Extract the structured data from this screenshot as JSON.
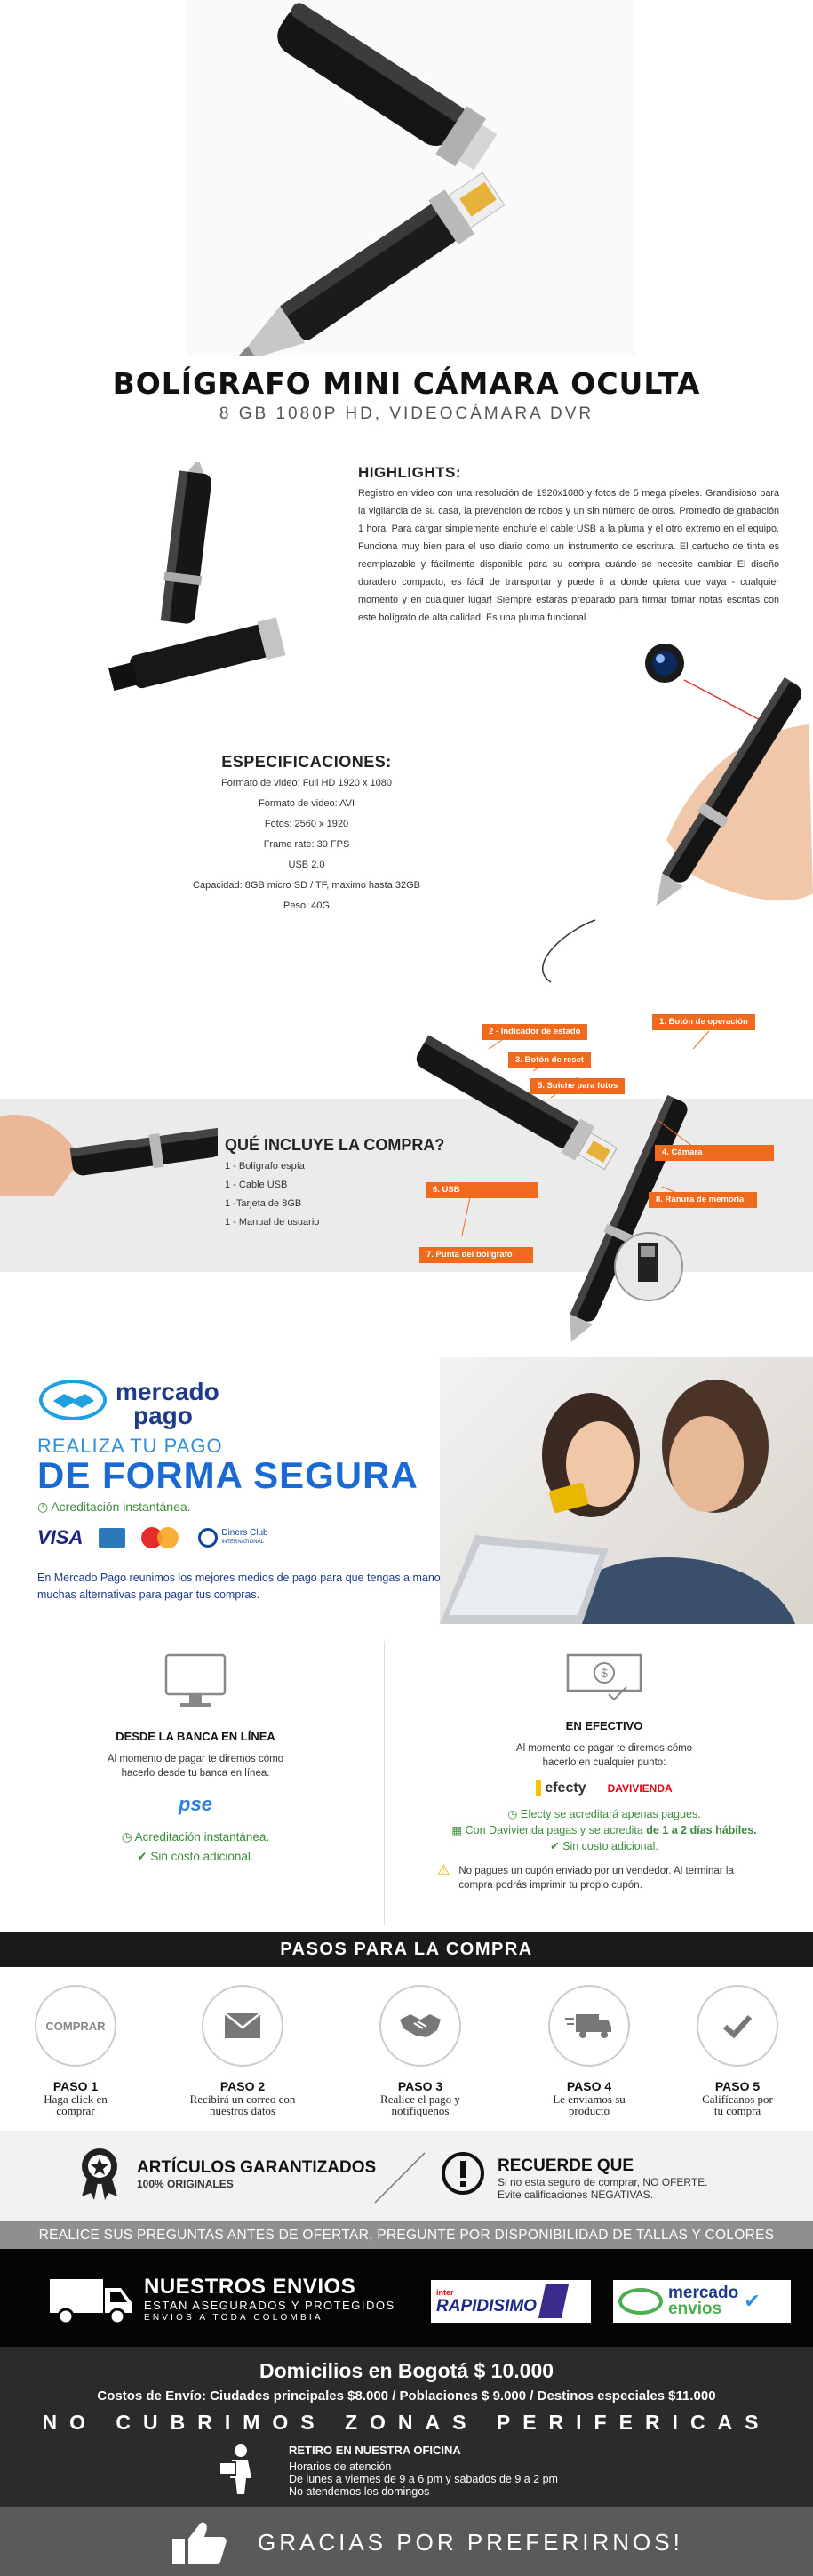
{
  "header": {
    "title": "BOLÍGRAFO MINI CÁMARA OCULTA",
    "subtitle": "8 GB 1080P HD, VIDEOCÁMARA DVR"
  },
  "highlights": {
    "title": "HIGHLIGHTS:",
    "text": "Registro en video con una resolución de 1920x1080 y fotos de 5 mega píxeles. Grandisioso para la vigilancia de su casa, la prevención de robos y un sin número de otros. Promedio de grabación 1 hora. Para cargar simplemente enchufe el cable USB a la pluma y el otro extremo en el equipo. Funciona muy bien para el uso diario como un instrumento de escritura. El cartucho de tinta es reemplazable y fácilmente disponible para su compra cuándo se necesite cambiar El diseño duradero compacto, es fácil de transportar y puede ir a donde quiera que vaya - cualquier momento y en cualquier lugar! Siempre estarás preparado para firmar  tomar notas escritas con este bolígrafo de alta calidad. Es una pluma funcional."
  },
  "specs": {
    "title": "ESPECIFICACIONES:",
    "items": [
      "Formato de video: Full HD 1920 x 1080",
      "Formato de video: AVI",
      "Fotos: 2560 x 1920",
      "Frame rate: 30 FPS",
      "USB 2.0",
      "Capacidad: 8GB micro SD / TF, maximo hasta 32GB",
      "Peso: 40G"
    ]
  },
  "includes": {
    "title": "QUÉ INCLUYE LA COMPRA?",
    "items": [
      "1 - Bolígrafo espía",
      "1 - Cable USB",
      "1 -Tarjeta de 8GB",
      "1 - Manual de usuario"
    ]
  },
  "diagram_tags": {
    "t1": "1. Botón de operación",
    "t2": "2 - Indicador de estado",
    "t3": "3. Botón de reset",
    "t4": "4. Cámara",
    "t5": "5. Suiche para fotos",
    "t6": "6. USB",
    "t7": "7. Punta del bolígrafo",
    "t8": "8. Ranura de memoria"
  },
  "mercadopago": {
    "logo_line1": "mercado",
    "logo_line2": "pago",
    "realiza": "REALIZA TU PAGO",
    "forma": "DE FORMA SEGURA",
    "acreditacion": "Acreditación instantánea.",
    "cards": [
      "VISA",
      "Diners Club"
    ],
    "cards_sub": "INTERNATIONAL",
    "description": "En Mercado Pago reunimos los mejores medios de pago para que tengas a mano muchas alternativas para pagar tus compras."
  },
  "pay_bank": {
    "title": "DESDE LA BANCA EN LÍNEA",
    "text": "Al momento de pagar te diremos cómo hacerlo desde tu banca en línea.",
    "pse": "pse",
    "acred": "Acreditación instantánea.",
    "nocost": "Sin costo adicional."
  },
  "pay_cash": {
    "title": "EN EFECTIVO",
    "text": "Al momento de pagar te diremos cómo hacerlo en cualquier punto:",
    "efecty": "efecty",
    "davivienda": "DAVIVIENDA",
    "note1": "Efecty se acreditará apenas pagues.",
    "note2_a": "Con Davivienda pagas y se acredita",
    "note2_b": "de 1 a 2 días hábiles.",
    "note3": "Sin costo adicional.",
    "warning": "No pagues un cupón enviado por un vendedor. Al terminar la compra podrás imprimir tu propio cupón."
  },
  "pasos": {
    "title": "PASOS PARA LA COMPRA",
    "comprar": "COMPRAR",
    "steps": [
      {
        "title": "PASO 1",
        "desc": "Haga click en comprar"
      },
      {
        "title": "PASO 2",
        "desc": "Recibirá un correo con nuestros datos"
      },
      {
        "title": "PASO 3",
        "desc": "Realice el pago y notifiquenos"
      },
      {
        "title": "PASO 4",
        "desc": "Le enviamos su producto"
      },
      {
        "title": "PASO 5",
        "desc": "Califícanos por tu compra"
      }
    ]
  },
  "guarantee": {
    "title": "ARTÍCULOS GARANTIZADOS",
    "sub": "100% ORIGINALES",
    "recuerde": "RECUERDE QUE",
    "recuerde_1": "Si no esta seguro de comprar, NO OFERTE.",
    "recuerde_2": "Evite calificaciones NEGATIVAS."
  },
  "notice": "REALICE SUS PREGUNTAS ANTES DE OFERTAR, PREGUNTE POR DISPONIBILIDAD DE TALLAS Y COLORES",
  "envios": {
    "title": "NUESTROS ENVIOS",
    "sub1": "ESTAN ASEGURADOS Y PROTEGIDOS",
    "sub2": "ENVIOS A TODA COLOMBIA",
    "rapidisimo_small": "inter",
    "rapidisimo": "RAPIDISIMO",
    "me_line1": "mercado",
    "me_line2": "envios"
  },
  "domicilios": {
    "title": "Domicilios en Bogotá $ 10.000",
    "costs": "Costos de Envío: Ciudades principales $8.000 / Poblaciones $ 9.000 / Destinos especiales $11.000",
    "no_cubrimos": "NO CUBRIMOS ZONAS PERIFERICAS",
    "retiro_title": "RETIRO EN NUESTRA OFICINA",
    "retiro_1": "Horarios de atención",
    "retiro_2": "De lunes a viernes de 9 a 6 pm y sabados de 9 a 2 pm",
    "retiro_3": "No atendemos los domingos"
  },
  "thanks": "GRACIAS POR PREFERIRNOS!",
  "colors": {
    "orange": "#ef6a1d",
    "mp_blue": "#1b6ad2",
    "green": "#3d8b3d"
  }
}
